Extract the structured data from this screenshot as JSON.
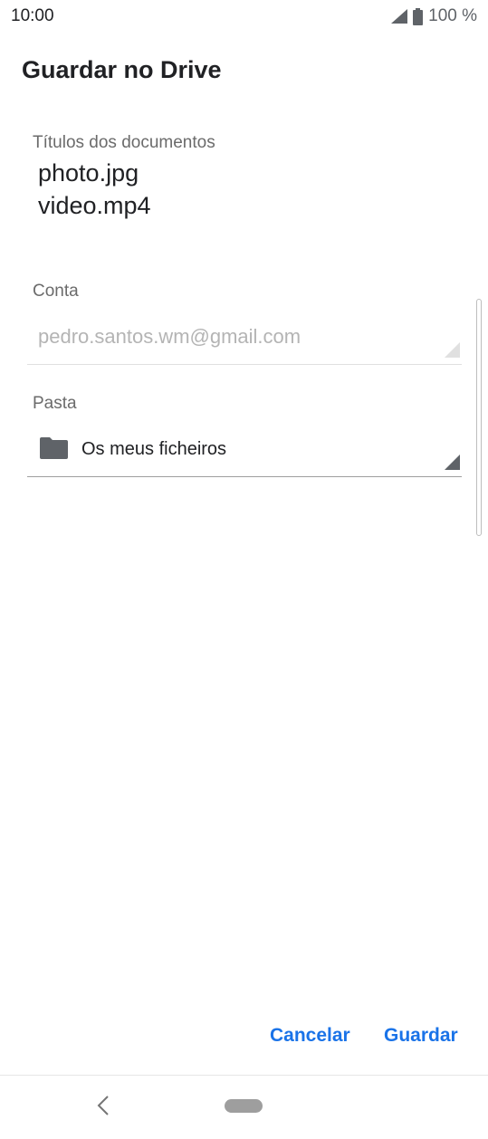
{
  "status_bar": {
    "time": "10:00",
    "battery": "100 %",
    "icons": [
      "signal-icon",
      "battery-icon"
    ]
  },
  "dialog": {
    "title": "Guardar no Drive"
  },
  "document_titles": {
    "label": "Títulos dos documentos",
    "items": [
      "photo.jpg",
      "video.mp4"
    ]
  },
  "account": {
    "label": "Conta",
    "value": "pedro.santos.wm@gmail.com"
  },
  "folder": {
    "label": "Pasta",
    "value": "Os meus ficheiros",
    "icon": "folder-icon"
  },
  "actions": {
    "cancel_label": "Cancelar",
    "save_label": "Guardar"
  },
  "colors": {
    "accent": "#1a73e8",
    "folder_icon": "#5f6368"
  }
}
